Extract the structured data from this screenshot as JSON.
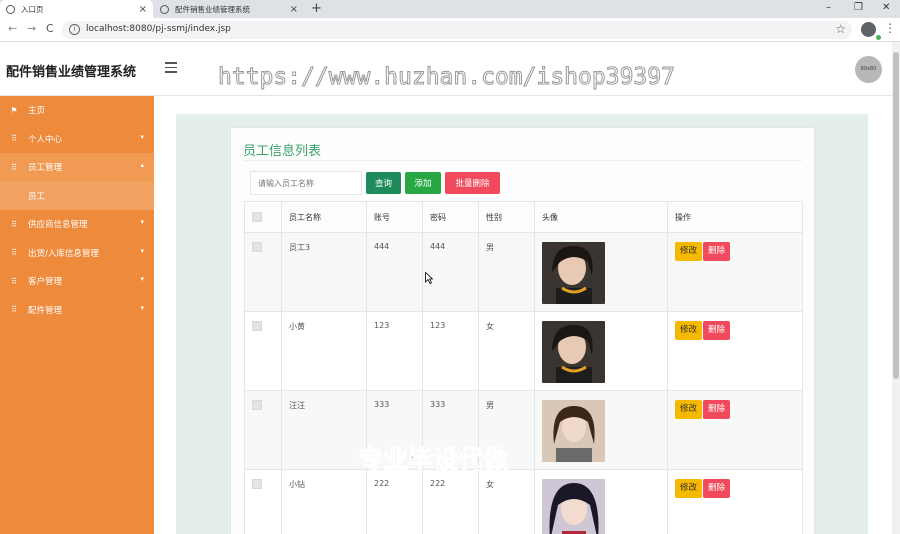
{
  "browser": {
    "tabs": [
      {
        "title": "入口页",
        "active": true
      },
      {
        "title": "配件销售业绩管理系统",
        "active": false
      }
    ],
    "url": "localhost:8080/pj-ssmj/index.jsp",
    "new_tab": "+",
    "tab_close": "×",
    "win_min": "–",
    "win_max": "❐",
    "win_close": "✕",
    "back": "←",
    "forward": "→",
    "reload": "C",
    "info": "i",
    "star": "☆",
    "menu": "⋮"
  },
  "header": {
    "brand": "配件销售业绩管理系统",
    "watermark": "https://www.huzhan.com/ishop39397",
    "avatar_text": "80x80"
  },
  "sidebar": {
    "items": [
      {
        "label": "主页",
        "icon": "flag-icon",
        "glyph": "⚑",
        "arrow": ""
      },
      {
        "label": "个人中心",
        "icon": "grid-icon",
        "glyph": "⠿",
        "arrow": "▾"
      },
      {
        "label": "员工管理",
        "icon": "grid-icon",
        "glyph": "⠿",
        "arrow": "▴"
      },
      {
        "label": "员工",
        "sub": true
      },
      {
        "label": "供应商信息管理",
        "icon": "grid-icon",
        "glyph": "⠿",
        "arrow": "▾"
      },
      {
        "label": "出货/入库信息管理",
        "icon": "grid-icon",
        "glyph": "⠿",
        "arrow": "▾"
      },
      {
        "label": "客户管理",
        "icon": "grid-icon",
        "glyph": "⠿",
        "arrow": "▾"
      },
      {
        "label": "配件管理",
        "icon": "grid-icon",
        "glyph": "⠿",
        "arrow": "▾"
      }
    ]
  },
  "main": {
    "title": "员工信息列表",
    "search_placeholder": "请输入员工名称",
    "btn_query": "查询",
    "btn_add": "添加",
    "btn_batch_delete": "批量删除",
    "columns": [
      "",
      "员工名称",
      "账号",
      "密码",
      "性别",
      "头像",
      "操作"
    ],
    "rows": [
      {
        "name": "员工3",
        "account": "444",
        "password": "444",
        "gender": "男",
        "edit": "修改",
        "delete": "删除"
      },
      {
        "name": "小黄",
        "account": "123",
        "password": "123",
        "gender": "女",
        "edit": "修改",
        "delete": "删除"
      },
      {
        "name": "汪汪",
        "account": "333",
        "password": "333",
        "gender": "男",
        "edit": "修改",
        "delete": "删除"
      },
      {
        "name": "小钻",
        "account": "222",
        "password": "222",
        "gender": "女",
        "edit": "修改",
        "delete": "删除"
      }
    ]
  },
  "overlay": "专业毕设代做",
  "colors": {
    "sidebar": "#ee8a3c",
    "title_green": "#3aa36b",
    "query": "#1f8a5a",
    "add": "#28a745",
    "danger": "#f04a5c",
    "warning": "#f5b900"
  }
}
